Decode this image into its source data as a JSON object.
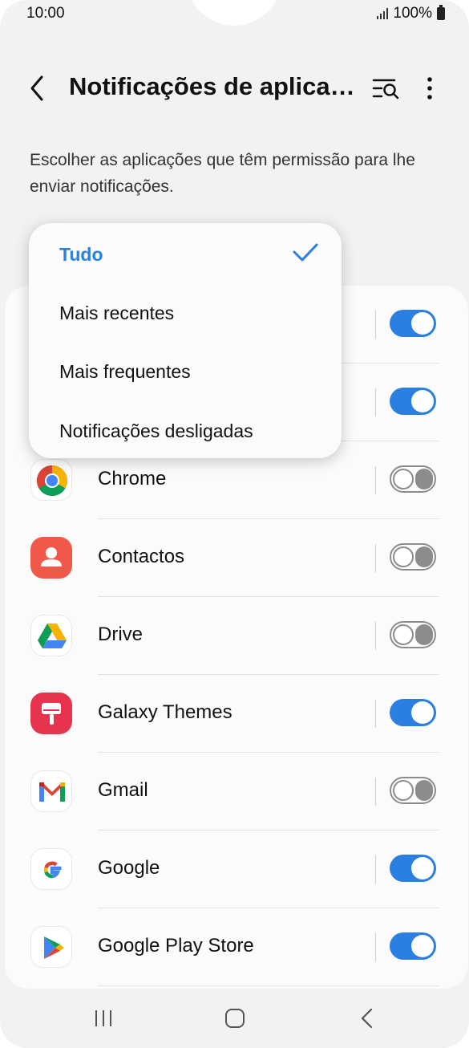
{
  "status": {
    "time": "10:00",
    "battery": "100%"
  },
  "header": {
    "title": "Notificações de aplicaç…"
  },
  "description": "Escolher as aplicações que têm permissão para lhe enviar notificações.",
  "dropdown": {
    "items": [
      {
        "label": "Tudo",
        "selected": true
      },
      {
        "label": "Mais recentes",
        "selected": false
      },
      {
        "label": "Mais frequentes",
        "selected": false
      },
      {
        "label": "Notificações desligadas",
        "selected": false
      }
    ]
  },
  "apps": [
    {
      "name": "",
      "on": true,
      "icon": "hidden-app-icon"
    },
    {
      "name": "",
      "on": true,
      "icon": "hidden-app-icon"
    },
    {
      "name": "Chrome",
      "on": false,
      "icon": "chrome-icon"
    },
    {
      "name": "Contactos",
      "on": false,
      "icon": "contacts-icon"
    },
    {
      "name": "Drive",
      "on": false,
      "icon": "drive-icon"
    },
    {
      "name": "Galaxy Themes",
      "on": true,
      "icon": "galaxy-themes-icon"
    },
    {
      "name": "Gmail",
      "on": false,
      "icon": "gmail-icon"
    },
    {
      "name": "Google",
      "on": true,
      "icon": "google-icon"
    },
    {
      "name": "Google Play Store",
      "on": true,
      "icon": "play-store-icon"
    }
  ],
  "colors": {
    "accent": "#2a7fe0",
    "toggle_off": "#8c8c8c"
  }
}
